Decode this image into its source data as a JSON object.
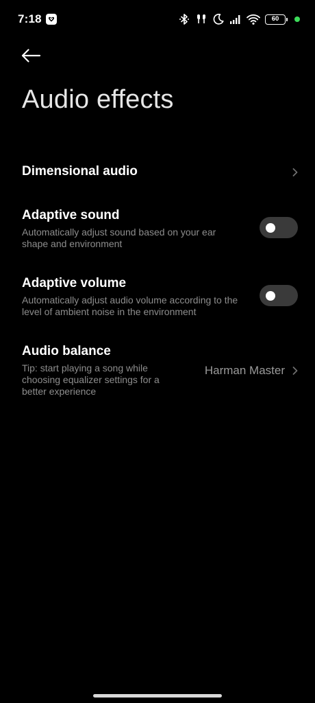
{
  "status_bar": {
    "time": "7:18",
    "battery_level": "60",
    "notification_icon": "gallery-icon",
    "icons": [
      "bluetooth-icon",
      "earbuds-icon",
      "moon-icon",
      "signal-icon",
      "wifi-icon"
    ],
    "dot_color": "#3ddc5a"
  },
  "header": {
    "back_icon": "back-arrow-icon",
    "title": "Audio effects"
  },
  "settings": {
    "dimensional_audio": {
      "title": "Dimensional audio"
    },
    "adaptive_sound": {
      "title": "Adaptive sound",
      "description": "Automatically adjust sound based on your ear shape and environment",
      "enabled": false
    },
    "adaptive_volume": {
      "title": "Adaptive volume",
      "description": "Automatically adjust audio volume according to the level of ambient noise in the environment",
      "enabled": false
    },
    "audio_balance": {
      "title": "Audio balance",
      "description": "Tip: start playing a song while choosing equalizer settings for a better experience",
      "value": "Harman Master"
    }
  },
  "colors": {
    "background": "#000000",
    "toggle_off_track": "#3a3a3a",
    "secondary_text": "#8d8d8d"
  }
}
